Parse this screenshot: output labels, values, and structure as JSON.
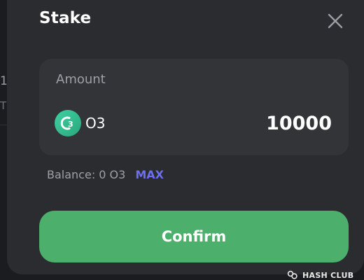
{
  "background": {
    "text_1": "1",
    "text_2": "T"
  },
  "modal": {
    "title": "Stake",
    "close_icon": "close-icon"
  },
  "amount_card": {
    "label": "Amount",
    "token": {
      "name": "O3",
      "logo_text": "3",
      "icon": "o3-token-logo"
    },
    "value": "10000"
  },
  "balance": {
    "text": "Balance: 0 O3",
    "max_label": "MAX"
  },
  "confirm": {
    "label": "Confirm"
  },
  "watermark": {
    "text": "HASH CLUB"
  },
  "colors": {
    "page_bg": "#17181b",
    "modal_bg": "#2b2c2f",
    "card_bg": "#333438",
    "accent_green": "#4caf6b",
    "max_link": "#6b6ff0",
    "muted_text": "#9da0a6"
  }
}
